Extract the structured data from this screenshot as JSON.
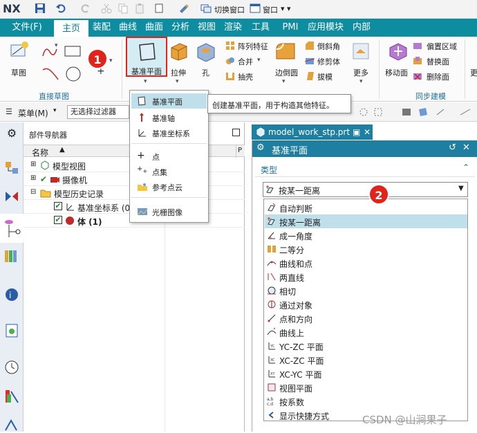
{
  "quickaccess": {
    "logo": "NX",
    "switch_window": "切换窗口",
    "window_menu": "窗口"
  },
  "tabs": [
    "文件(F)",
    "主页",
    "装配",
    "曲线",
    "曲面",
    "分析",
    "视图",
    "渲染",
    "工具",
    "PMI",
    "应用模块",
    "内部"
  ],
  "active_tab": "主页",
  "ribbon": {
    "sketch": "草图",
    "group_direct_sketch": "直接草图",
    "datum_plane": "基准平面",
    "extrude": "拉伸",
    "hole": "孔",
    "pattern_feature": "阵列特征",
    "unite": "合并",
    "shell": "抽壳",
    "edge_blend": "边倒圆",
    "chamfer": "倒斜角",
    "trim_body": "修剪体",
    "draft": "拔模",
    "more": "更多",
    "move_face": "移动面",
    "offset_region": "偏置区域",
    "replace_face": "替换面",
    "delete_face": "删除面",
    "group_sync": "同步建模",
    "cut_label": "更"
  },
  "selbar": {
    "menu": "菜单(M)",
    "filter": "无选择过滤器"
  },
  "navigator": {
    "title": "部件导航器",
    "col_name": "名称",
    "rows": [
      {
        "label": "模型视图"
      },
      {
        "label": "摄像机"
      },
      {
        "label": "模型历史记录"
      },
      {
        "label": "基准坐标系 (0)"
      },
      {
        "label": "体 (1)"
      }
    ]
  },
  "datum_menu": {
    "items": [
      "基准平面",
      "基准轴",
      "基准坐标系",
      "点",
      "点集",
      "参考点云",
      "光栅图像"
    ]
  },
  "tooltip": "创建基准平面，用于构造其他特征。",
  "file_tab": "model_work_stp.prt",
  "dialog": {
    "title": "基准平面",
    "section_type": "类型",
    "selected_type": "按某一距离",
    "types": [
      "自动判断",
      "按某一距离",
      "成一角度",
      "二等分",
      "曲线和点",
      "两直线",
      "相切",
      "通过对象",
      "点和方向",
      "曲线上",
      "YC-ZC 平面",
      "XC-ZC 平面",
      "XC-YC 平面",
      "视图平面",
      "按系数",
      "显示快捷方式"
    ]
  },
  "badges": [
    "1",
    "2"
  ],
  "watermark": "CSDN @山涧果子",
  "colors": {
    "tab_bar": "#0f8da0",
    "dialog_header": "#1f7fa0",
    "highlight": "#bfe0ea",
    "badge": "#e0231b",
    "group_label": "#1f6f9a"
  }
}
